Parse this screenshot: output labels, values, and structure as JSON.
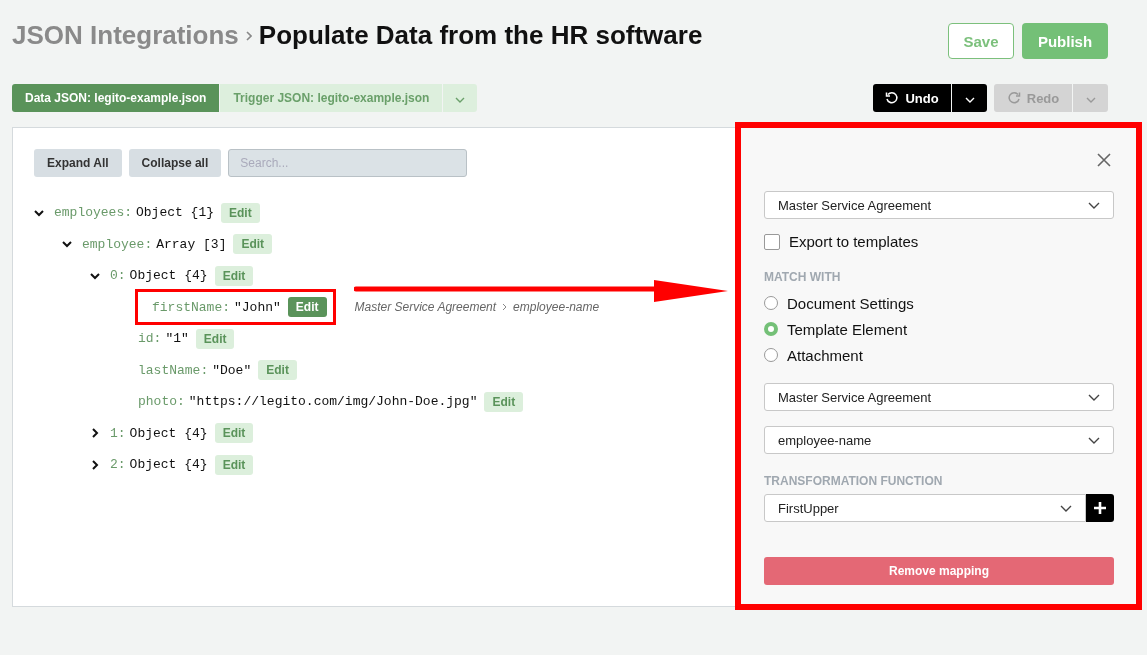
{
  "header": {
    "breadcrumb": "JSON Integrations",
    "title": "Populate Data from the HR software",
    "save": "Save",
    "publish": "Publish"
  },
  "source_tabs": [
    {
      "label": "Data JSON: legito-example.json",
      "selected": true
    },
    {
      "label": "Trigger JSON: legito-example.json",
      "selected": false
    }
  ],
  "history": {
    "undo": {
      "label": "Undo",
      "disabled": false
    },
    "redo": {
      "label": "Redo",
      "disabled": true
    }
  },
  "toolbar": {
    "expand_all": "Expand All",
    "collapse_all": "Collapse all",
    "search_placeholder": "Search..."
  },
  "tree": [
    {
      "key": "employees:",
      "value": "Object {1}",
      "expanded": true,
      "selected": false,
      "edit": "Edit",
      "children": [
        {
          "key": "employee:",
          "value": "Array [3]",
          "expanded": true,
          "selected": false,
          "edit": "Edit",
          "children": [
            {
              "key": "0:",
              "value": "Object {4}",
              "expanded": true,
              "selected": false,
              "edit": "Edit",
              "children": [
                {
                  "key": "firstName:",
                  "value": "\"John\"",
                  "selected": true,
                  "highlighted": true,
                  "edit": "Edit",
                  "mapping": [
                    "Master Service Agreement",
                    "employee-name"
                  ]
                },
                {
                  "key": "id:",
                  "value": "\"1\"",
                  "selected": false,
                  "highlighted": false,
                  "edit": "Edit"
                },
                {
                  "key": "lastName:",
                  "value": "\"Doe\"",
                  "selected": false,
                  "highlighted": false,
                  "edit": "Edit"
                },
                {
                  "key": "photo:",
                  "value": "\"https://legito.com/img/John-Doe.jpg\"",
                  "selected": false,
                  "highlighted": false,
                  "edit": "Edit"
                }
              ]
            },
            {
              "key": "1:",
              "value": "Object {4}",
              "expanded": false,
              "selected": false,
              "edit": "Edit"
            },
            {
              "key": "2:",
              "value": "Object {4}",
              "expanded": false,
              "selected": false,
              "edit": "Edit"
            }
          ]
        }
      ]
    }
  ],
  "mapping_panel": {
    "document": "Master Service Agreement",
    "export": {
      "label": "Export to templates",
      "checked": false
    },
    "match_heading": "MATCH WITH",
    "match_options": [
      {
        "label": "Document Settings",
        "selected": false
      },
      {
        "label": "Template Element",
        "selected": true
      },
      {
        "label": "Attachment",
        "selected": false
      }
    ],
    "template": "Master Service Agreement",
    "element": "employee-name",
    "transform_heading": "TRANSFORMATION FUNCTION",
    "transform": "FirstUpper",
    "remove": "Remove mapping"
  }
}
